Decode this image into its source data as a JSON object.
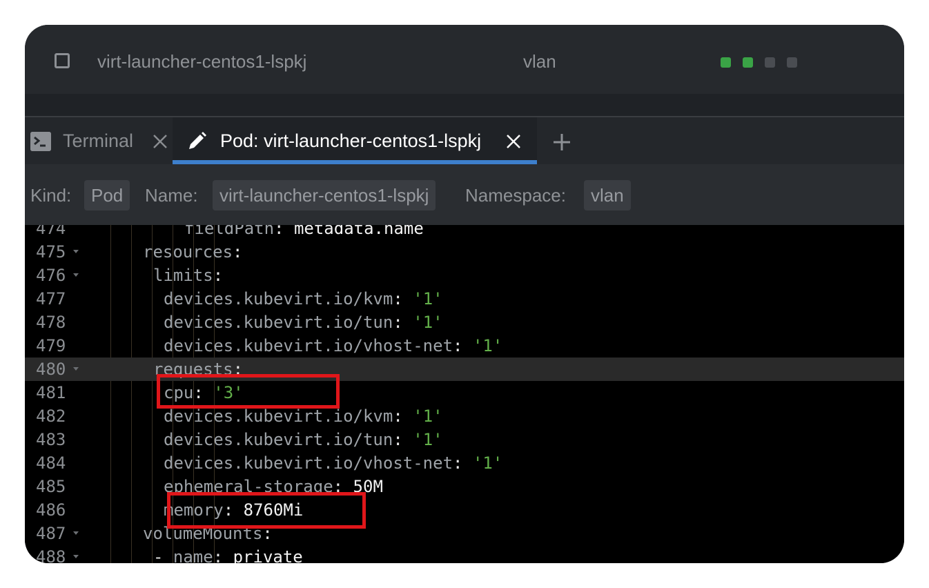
{
  "resource_row": {
    "name": "virt-launcher-centos1-lspkj",
    "namespace": "vlan",
    "container_status_colors": [
      "#3aa346",
      "#3aa346",
      "#4a4d52",
      "#4a4d52"
    ]
  },
  "tabs": [
    {
      "label": "Terminal",
      "icon": "terminal-icon",
      "active": false
    },
    {
      "label": "Pod: virt-launcher-centos1-lspkj",
      "icon": "pencil-icon",
      "active": true
    }
  ],
  "info": {
    "kind_label": "Kind:",
    "kind_value": "Pod",
    "name_label": "Name:",
    "name_value": "virt-launcher-centos1-lspkj",
    "namespace_label": "Namespace:",
    "namespace_value": "vlan"
  },
  "editor": {
    "lines": [
      {
        "n": "474",
        "fold": false,
        "indent": 10,
        "key": "fieldPath",
        "value": "metadata.name",
        "vtype": "plain"
      },
      {
        "n": "475",
        "fold": true,
        "indent": 6,
        "key": "resources",
        "value": "",
        "vtype": "none"
      },
      {
        "n": "476",
        "fold": true,
        "indent": 7,
        "key": "limits",
        "value": "",
        "vtype": "none"
      },
      {
        "n": "477",
        "fold": false,
        "indent": 8,
        "key": "devices.kubevirt.io/kvm",
        "value": "'1'",
        "vtype": "string"
      },
      {
        "n": "478",
        "fold": false,
        "indent": 8,
        "key": "devices.kubevirt.io/tun",
        "value": "'1'",
        "vtype": "string"
      },
      {
        "n": "479",
        "fold": false,
        "indent": 8,
        "key": "devices.kubevirt.io/vhost-net",
        "value": "'1'",
        "vtype": "string"
      },
      {
        "n": "480",
        "fold": true,
        "indent": 7,
        "key": "requests",
        "value": "",
        "vtype": "none",
        "active": true
      },
      {
        "n": "481",
        "fold": false,
        "indent": 8,
        "key": "cpu",
        "value": "'3'",
        "vtype": "string"
      },
      {
        "n": "482",
        "fold": false,
        "indent": 8,
        "key": "devices.kubevirt.io/kvm",
        "value": "'1'",
        "vtype": "string"
      },
      {
        "n": "483",
        "fold": false,
        "indent": 8,
        "key": "devices.kubevirt.io/tun",
        "value": "'1'",
        "vtype": "string"
      },
      {
        "n": "484",
        "fold": false,
        "indent": 8,
        "key": "devices.kubevirt.io/vhost-net",
        "value": "'1'",
        "vtype": "string"
      },
      {
        "n": "485",
        "fold": false,
        "indent": 8,
        "key": "ephemeral-storage",
        "value": "50M",
        "vtype": "plain"
      },
      {
        "n": "486",
        "fold": false,
        "indent": 8,
        "key": "memory",
        "value": "8760Mi",
        "vtype": "plain"
      },
      {
        "n": "487",
        "fold": true,
        "indent": 6,
        "key": "volumeMounts",
        "value": "",
        "vtype": "none"
      },
      {
        "n": "488",
        "fold": true,
        "indent": 7,
        "key": "name",
        "value": "private",
        "vtype": "plain",
        "dash": true
      }
    ]
  },
  "highlight_color": "#e0161a"
}
